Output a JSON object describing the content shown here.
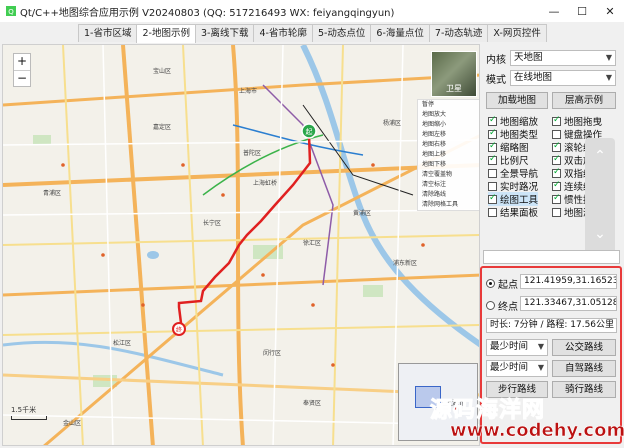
{
  "window": {
    "title": "Qt/C++地图综合应用示例 V20240803 (QQ: 517216493 WX: feiyangqingyun)",
    "minimize": "—",
    "maximize": "☐",
    "close": "✕"
  },
  "tabs": [
    "1-省市区域",
    "2-地图示例",
    "3-离线下载",
    "4-省市轮廓",
    "5-动态点位",
    "6-海量点位",
    "7-动态轨迹",
    "X-网页控件"
  ],
  "map": {
    "zoom_in": "+",
    "zoom_out": "−",
    "satellite_label": "卫星",
    "context_menu": [
      "暂停",
      "地图放大",
      "地图缩小",
      "地图左移",
      "地图右移",
      "地图上移",
      "地图下移",
      "清空覆盖物",
      "清空标注",
      "清除路线",
      "清除网格工具"
    ],
    "scale_text": "1.5千米",
    "overview_label": "上海市",
    "labels": [
      "嘉定区",
      "上海市",
      "上海虹桥",
      "青浦区",
      "松江区",
      "闵行区",
      "浦东新区",
      "宝山区",
      "黄浦区",
      "徐汇区",
      "普陀区",
      "长宁区",
      "杨浦区",
      "奉贤区",
      "金山区"
    ],
    "marker_start": "起",
    "marker_end": "终"
  },
  "panel": {
    "kernel_label": "内核",
    "kernel_value": "天地图",
    "style_label": "模式",
    "style_value": "在线地图",
    "load_button": "加载地图",
    "demo_button": "层高示例",
    "checkboxes": [
      {
        "label": "地图缩放",
        "checked": true
      },
      {
        "label": "地图拖曳",
        "checked": true
      },
      {
        "label": "地图类型",
        "checked": true
      },
      {
        "label": "键盘操作",
        "checked": false
      },
      {
        "label": "缩略图",
        "checked": true
      },
      {
        "label": "滚轮缩放",
        "checked": true
      },
      {
        "label": "比例尺",
        "checked": true
      },
      {
        "label": "双击放大",
        "checked": true
      },
      {
        "label": "全景导航",
        "checked": false
      },
      {
        "label": "双指缩放",
        "checked": true
      },
      {
        "label": "实时路况",
        "checked": false
      },
      {
        "label": "连续缩放",
        "checked": true
      },
      {
        "label": "绘图工具",
        "checked": true
      },
      {
        "label": "惯性拖曳",
        "checked": true
      },
      {
        "label": "结果面板",
        "checked": false
      },
      {
        "label": "地图测距",
        "checked": false
      }
    ],
    "scroll_up": "⌃",
    "scroll_down": "⌄"
  },
  "route": {
    "start_label": "起点",
    "start_value": "121.41959,31.16523",
    "end_label": "终点",
    "end_value": "121.33467,31.05128",
    "summary": "时长: 7分钟 / 路程: 17.56公里",
    "policy_1": "最少时间",
    "transit_button": "公交路线",
    "policy_2": "最少时间",
    "driving_button": "自驾路线",
    "walking_button": "步行路线",
    "riding_button": "骑行路线"
  },
  "watermark": {
    "line1": "源码海洋网",
    "line2": "www.codehy.com"
  }
}
